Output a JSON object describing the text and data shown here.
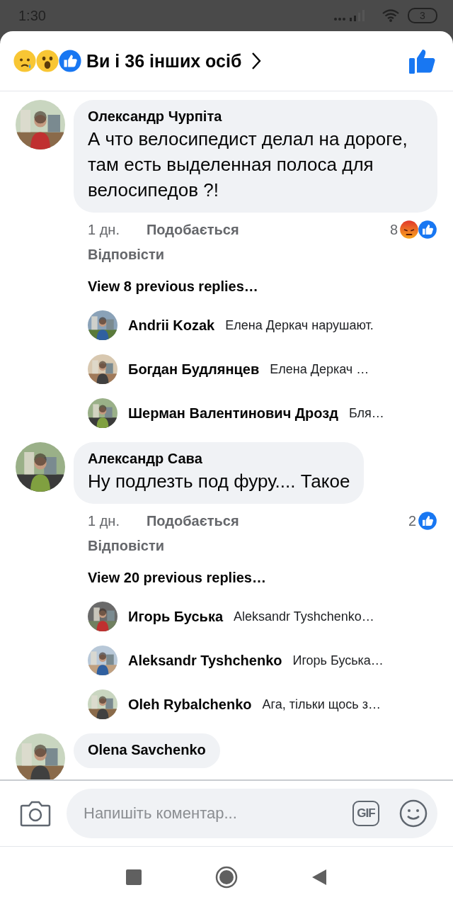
{
  "status_bar": {
    "time": "1:30",
    "battery": "3"
  },
  "header": {
    "reactions": [
      {
        "kind": "sad"
      },
      {
        "kind": "wow"
      },
      {
        "kind": "like"
      }
    ],
    "summary": "Ви і 36 інших осіб"
  },
  "comments": [
    {
      "author": "Олександр Чурпіта",
      "text": "А что велосипедист делал на дороге, там есть выделенная полоса для велосипедов ?!",
      "time": "1 дн.",
      "like_label": "Подобається",
      "reply_label": "Відповісти",
      "reaction_count": "8",
      "reactions": [
        {
          "kind": "angry"
        },
        {
          "kind": "like"
        }
      ],
      "view_replies": "View 8 previous replies…",
      "replies": [
        {
          "author": "Andrii Kozak",
          "text": "Елена Деркач нарушают."
        },
        {
          "author": "Богдан Будлянцев",
          "text": "Елена Деркач …"
        },
        {
          "author": "Шерман Валентинович Дрозд",
          "text": "Бля…"
        }
      ]
    },
    {
      "author": "Александр Сава",
      "text": "Ну подлезть под фуру.... Такое",
      "time": "1 дн.",
      "like_label": "Подобається",
      "reply_label": "Відповісти",
      "reaction_count": "2",
      "reactions": [
        {
          "kind": "like"
        }
      ],
      "view_replies": "View 20 previous replies…",
      "replies": [
        {
          "author": "Игорь Буська",
          "text": "Aleksandr Tyshchenko…"
        },
        {
          "author": "Aleksandr Tyshchenko",
          "text": "Игорь Буська…"
        },
        {
          "author": "Oleh Rybalchenko",
          "text": "Ага, тільки щось з…"
        }
      ]
    },
    {
      "author": "Olena Savchenko"
    }
  ],
  "composer": {
    "placeholder": "Напишіть коментар...",
    "gif_label": "GIF"
  }
}
